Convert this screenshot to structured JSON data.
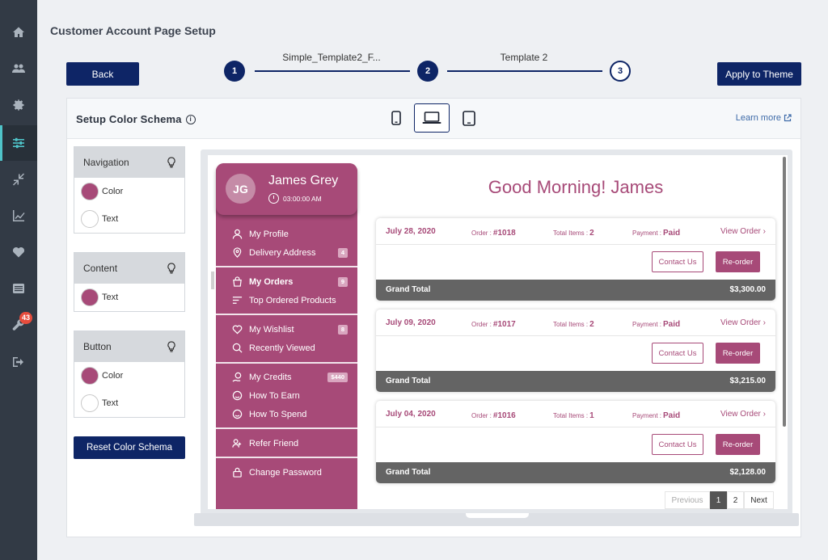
{
  "page": {
    "title": "Customer Account Page Setup"
  },
  "sidebar": {
    "icons": [
      "home-icon",
      "users-icon",
      "gear-icon",
      "sliders-icon",
      "compress-icon",
      "chart-line-icon",
      "heart-icon",
      "list-icon",
      "wrench-icon",
      "sign-out-icon"
    ],
    "active_index": 3,
    "badge": "43"
  },
  "toolbar": {
    "back_label": "Back",
    "apply_label": "Apply to Theme"
  },
  "stepper": {
    "steps": [
      {
        "number": "1",
        "label": ""
      },
      {
        "number": "2",
        "label": "Simple_Template2_F..."
      },
      {
        "number": "3",
        "label": "Template 2"
      }
    ]
  },
  "schema": {
    "title": "Setup Color Schema",
    "learn_more": "Learn more",
    "reset_label": "Reset Color Schema",
    "panels": {
      "navigation": {
        "title": "Navigation",
        "color_label": "Color",
        "text_label": "Text",
        "color": "#a74a78",
        "text_color": "#ffffff"
      },
      "content": {
        "title": "Content",
        "text_label": "Text",
        "text_color": "#a74a78"
      },
      "button": {
        "title": "Button",
        "color_label": "Color",
        "text_label": "Text",
        "color": "#a74a78",
        "text_color": "#ffffff"
      }
    },
    "devices": [
      "mobile-icon",
      "laptop-icon",
      "tablet-icon"
    ],
    "active_device": "laptop-icon"
  },
  "preview": {
    "customer": {
      "initials": "JG",
      "name": "James Grey",
      "time": "03:00:00 AM"
    },
    "greeting": "Good Morning! James",
    "menu": {
      "profile": "My Profile",
      "delivery": "Delivery Address",
      "delivery_badge": "4",
      "orders": "My Orders",
      "orders_badge": "9",
      "top_ordered": "Top Ordered Products",
      "wishlist": "My Wishlist",
      "wishlist_badge": "8",
      "recently": "Recently Viewed",
      "credits": "My Credits",
      "credits_badge": "$440",
      "earn": "How To Earn",
      "spend": "How To Spend",
      "refer": "Refer Friend",
      "password": "Change Password"
    },
    "order_labels": {
      "order": "Order :",
      "items": "Total Items :",
      "payment": "Payment :",
      "view": "View Order",
      "contact": "Contact Us",
      "reorder": "Re-order",
      "grand_total": "Grand Total"
    },
    "orders": [
      {
        "date": "July 28, 2020",
        "number": "#1018",
        "items": "2",
        "payment": "Paid",
        "total": "$3,300.00"
      },
      {
        "date": "July 09, 2020",
        "number": "#1017",
        "items": "2",
        "payment": "Paid",
        "total": "$3,215.00"
      },
      {
        "date": "July 04, 2020",
        "number": "#1016",
        "items": "1",
        "payment": "Paid",
        "total": "$2,128.00"
      }
    ],
    "pagination": {
      "previous": "Previous",
      "current": "1",
      "page2": "2",
      "next": "Next"
    }
  }
}
